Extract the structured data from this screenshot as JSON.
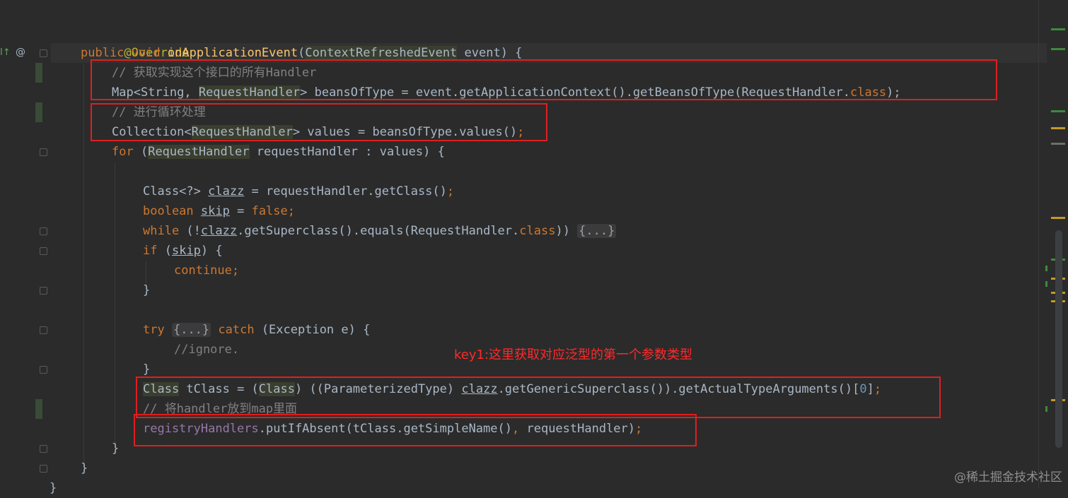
{
  "editor": {
    "lines": {
      "l2": {
        "ann": "@Override"
      },
      "l3": {
        "kw1": "public",
        "kw2": "void",
        "fn": "onApplicationEvent",
        "p1": "(",
        "type": "ContextRefreshedEvent",
        "p2": " event) {"
      },
      "l4": {
        "cmt": "// 获取实现这个接口的所有Handler"
      },
      "l5": {
        "p1": "Map<String, ",
        "type": "RequestHandler",
        "p2": "> beansOfType = event.getApplicationContext().getBeansOfType(RequestHandler.",
        "kw": "class",
        "p3": ");"
      },
      "l6": {
        "cmt": "// 进行循环处理"
      },
      "l7": {
        "p1": "Collection<",
        "type": "RequestHandler",
        "p2": "> values = beansOfType.values()",
        "semi": ";"
      },
      "l8": {
        "kw": "for",
        "p1": " (",
        "type": "RequestHandler",
        "p2": " requestHandler : values) {"
      },
      "l10": {
        "p1": "Class<?> ",
        "var": "clazz",
        "p2": " = requestHandler.getClass()",
        "semi": ";"
      },
      "l11": {
        "kw": "boolean",
        "p1": " ",
        "var": "skip",
        "p2": " = ",
        "kw2": "false",
        "semi": ";"
      },
      "l12": {
        "kw": "while",
        "p1": " (!",
        "var": "clazz",
        "p2": ".getSuperclass().equals(RequestHandler.",
        "kw2": "class",
        "p3": ")) ",
        "fold": "{...}"
      },
      "l13": {
        "kw": "if",
        "p1": " (",
        "var": "skip",
        "p2": ") {"
      },
      "l14": {
        "kw": "continue",
        "semi": ";"
      },
      "l15": {
        "p1": "}"
      },
      "l17": {
        "kw": "try",
        "p1": " ",
        "fold": "{...}",
        "kw2": " catch",
        "p2": " (Exception e) {"
      },
      "l18": {
        "cmt": "//ignore."
      },
      "l19": {
        "p1": "}"
      },
      "l20": {
        "type1": "Class",
        "p1": " tClass = (",
        "type2": "Class",
        "p2": ") ((ParameterizedType) ",
        "var": "clazz",
        "p3": ".getGenericSuperclass()).getActualTypeArguments()[",
        "num": "0",
        "p4": "]",
        "semi": ";"
      },
      "l21": {
        "cmt": "// 将handler放到map里面"
      },
      "l22": {
        "field": "registryHandlers",
        "p1": ".putIfAbsent(tClass.getSimpleName()",
        "comma": ",",
        "p2": " requestHandler)",
        "semi": ";"
      },
      "l23": {
        "p1": "}"
      },
      "l24": {
        "p1": "}"
      },
      "l25": {
        "p1": "}"
      }
    },
    "gutter_icons": {
      "implements": "I↑",
      "annotation": "@"
    }
  },
  "annotation": {
    "text": "key1:这里获取对应泛型的第一个参数类型"
  },
  "watermark": {
    "text": "@稀土掘金技术社区"
  },
  "colors": {
    "background": "#2b2b2b",
    "keyword": "#cc7832",
    "annotation": "#bbb529",
    "method": "#ffc66d",
    "comment": "#808080",
    "field": "#9876aa",
    "text": "#a9b7c6",
    "highlight_box": "#e11e1e"
  }
}
